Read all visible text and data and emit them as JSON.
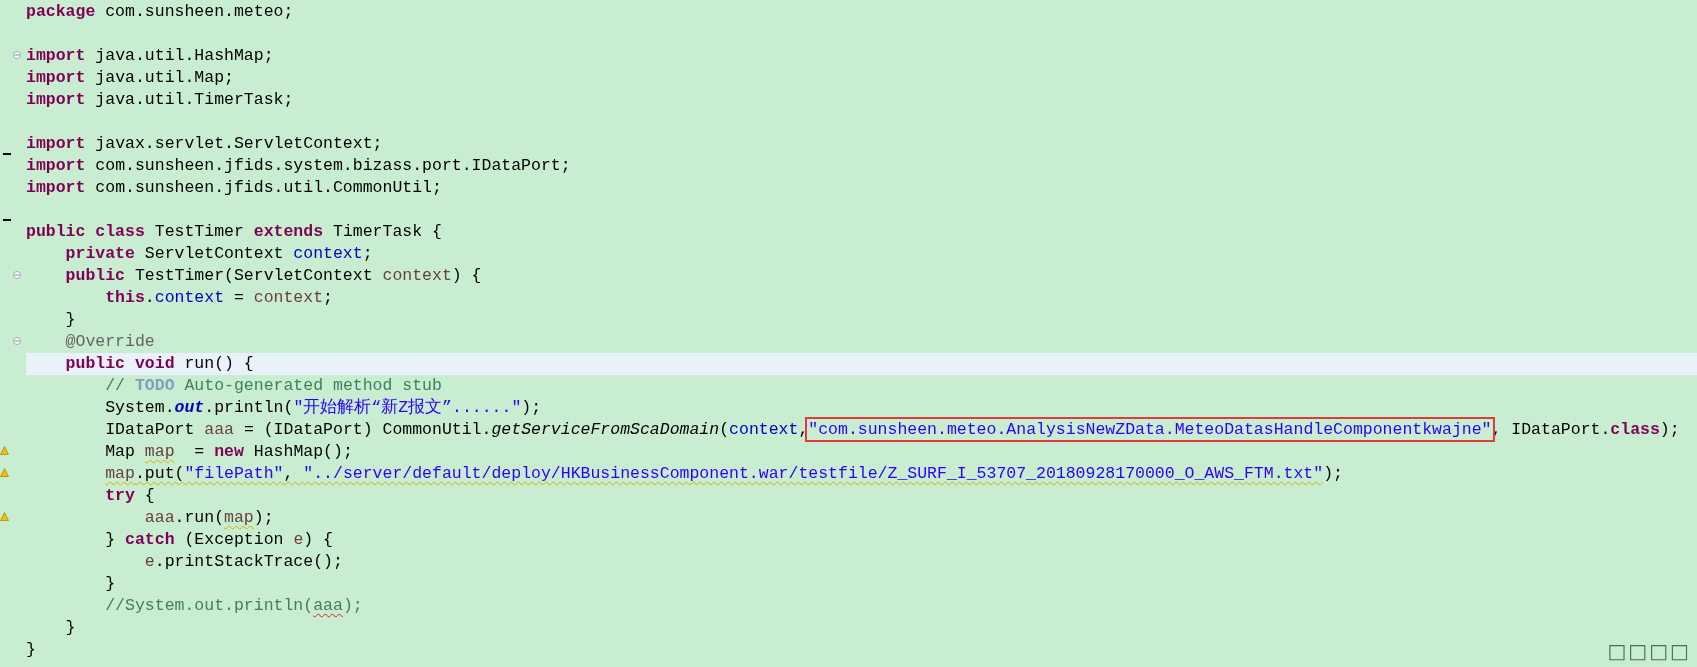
{
  "editor": {
    "lines": [
      {
        "current": false,
        "tokens": [
          {
            "kind": "keyword",
            "text": "package"
          },
          {
            "kind": "plain",
            "text": " com.sunsheen.meteo;"
          }
        ]
      },
      {
        "current": false
      },
      {
        "current": false,
        "expanded": true,
        "tokens": [
          {
            "kind": "keyword",
            "text": "import"
          },
          {
            "kind": "plain",
            "text": " java.util.HashMap;"
          }
        ]
      },
      {
        "current": false,
        "tokens": [
          {
            "kind": "keyword",
            "text": "import"
          },
          {
            "kind": "plain",
            "text": " java.util.Map;"
          }
        ]
      },
      {
        "current": false,
        "tokens": [
          {
            "kind": "keyword",
            "text": "import"
          },
          {
            "kind": "plain",
            "text": " java.util.TimerTask;"
          }
        ]
      },
      {
        "current": false
      },
      {
        "current": false,
        "tokens": [
          {
            "kind": "keyword",
            "text": "import"
          },
          {
            "kind": "plain",
            "text": " javax.servlet.ServletContext;"
          }
        ]
      },
      {
        "current": false,
        "changed": true,
        "tokens": [
          {
            "kind": "keyword",
            "text": "import"
          },
          {
            "kind": "plain",
            "text": " com.sunsheen.jfids.system.bizass.port.IDataPort;"
          }
        ]
      },
      {
        "current": false,
        "tokens": [
          {
            "kind": "keyword",
            "text": "import"
          },
          {
            "kind": "plain",
            "text": " com.sunsheen.jfids.util.CommonUtil;"
          }
        ]
      },
      {
        "current": false
      },
      {
        "current": false,
        "changed": true,
        "tokens": [
          {
            "kind": "keyword",
            "text": "public class"
          },
          {
            "kind": "plain",
            "text": " TestTimer "
          },
          {
            "kind": "keyword",
            "text": "extends"
          },
          {
            "kind": "plain",
            "text": " TimerTask {"
          }
        ]
      },
      {
        "current": false,
        "tokens": [
          {
            "kind": "keyword",
            "text": "    private"
          },
          {
            "kind": "plain",
            "text": " ServletContext "
          },
          {
            "kind": "field",
            "text": "context"
          },
          {
            "kind": "plain",
            "text": ";"
          }
        ]
      },
      {
        "current": false,
        "expanded": true,
        "tokens": [
          {
            "kind": "keyword",
            "text": "    public"
          },
          {
            "kind": "plain",
            "text": " TestTimer(ServletContext "
          },
          {
            "kind": "param",
            "text": "context"
          },
          {
            "kind": "plain",
            "text": ") {"
          }
        ]
      },
      {
        "current": false,
        "tokens": [
          {
            "kind": "keyword",
            "text": "        this"
          },
          {
            "kind": "plain",
            "text": "."
          },
          {
            "kind": "field",
            "text": "context"
          },
          {
            "kind": "plain",
            "text": " = "
          },
          {
            "kind": "param",
            "text": "context"
          },
          {
            "kind": "plain",
            "text": ";"
          }
        ]
      },
      {
        "current": false,
        "tokens": [
          {
            "kind": "plain",
            "text": "    }"
          }
        ]
      },
      {
        "current": false,
        "expanded": true,
        "tokens": [
          {
            "kind": "annotation",
            "text": "    @Override"
          }
        ]
      },
      {
        "current": true,
        "tokens": [
          {
            "kind": "keyword",
            "text": "    public void"
          },
          {
            "kind": "plain",
            "text": " run() {"
          }
        ]
      },
      {
        "current": false,
        "tokens": [
          {
            "kind": "comment",
            "text": "        // "
          },
          {
            "kind": "todo",
            "text": "TODO"
          },
          {
            "kind": "comment",
            "text": " Auto-generated method stub"
          }
        ]
      },
      {
        "current": false,
        "tokens": [
          {
            "kind": "plain",
            "text": "        System."
          },
          {
            "kind": "static",
            "text": "out"
          },
          {
            "kind": "plain",
            "text": ".println("
          },
          {
            "kind": "string",
            "text": "\"开始解析“新Z报文”......\""
          },
          {
            "kind": "plain",
            "text": ");"
          }
        ]
      },
      {
        "current": false,
        "tokens": [
          {
            "kind": "plain",
            "text": "        IDataPort "
          },
          {
            "kind": "param",
            "text": "aaa"
          },
          {
            "kind": "plain",
            "text": " = (IDataPort) CommonUtil."
          },
          {
            "kind": "method",
            "text": "getServiceFromScaDomain"
          },
          {
            "kind": "plain",
            "text": "("
          },
          {
            "kind": "field",
            "text": "context"
          },
          {
            "kind": "plain",
            "text": ","
          },
          {
            "kind": "string",
            "text": "\"com.sunsheen.meteo.AnalysisNewZData.MeteoDatasHandleComponentkwajne\"",
            "boxed": true
          },
          {
            "kind": "plain",
            "text": ", IDataPort."
          },
          {
            "kind": "keyword",
            "text": "class"
          },
          {
            "kind": "plain",
            "text": ");"
          }
        ]
      },
      {
        "current": false,
        "warning": true,
        "tokens": [
          {
            "kind": "plain",
            "text": "        Map "
          },
          {
            "kind": "param",
            "text": "map",
            "warning_underline": true
          },
          {
            "kind": "plain",
            "text": "  = "
          },
          {
            "kind": "keyword",
            "text": "new"
          },
          {
            "kind": "plain",
            "text": " HashMap();"
          }
        ]
      },
      {
        "current": false,
        "warning": true,
        "tokens": [
          {
            "kind": "param",
            "text": "        map",
            "warning_underline": true
          },
          {
            "kind": "plain",
            "text": ".put(",
            "warning_underline": true
          },
          {
            "kind": "string",
            "text": "\"filePath\"",
            "warning_underline": true
          },
          {
            "kind": "plain",
            "text": ", ",
            "warning_underline": true
          },
          {
            "kind": "string",
            "text": "\"../server/default/deploy/HKBusinessComponent.war/testfile/Z_SURF_I_53707_20180928170000_O_AWS_FTM.txt\"",
            "warning_underline": true
          },
          {
            "kind": "plain",
            "text": ");"
          }
        ]
      },
      {
        "current": false,
        "tokens": [
          {
            "kind": "keyword",
            "text": "        try"
          },
          {
            "kind": "plain",
            "text": " {"
          }
        ]
      },
      {
        "current": false,
        "warning": true,
        "tokens": [
          {
            "kind": "param",
            "text": "            aaa"
          },
          {
            "kind": "plain",
            "text": ".run("
          },
          {
            "kind": "param",
            "text": "map",
            "warning_underline": true
          },
          {
            "kind": "plain",
            "text": ");"
          }
        ]
      },
      {
        "current": false,
        "tokens": [
          {
            "kind": "plain",
            "text": "        } "
          },
          {
            "kind": "keyword",
            "text": "catch"
          },
          {
            "kind": "plain",
            "text": " (Exception "
          },
          {
            "kind": "param",
            "text": "e"
          },
          {
            "kind": "plain",
            "text": ") {"
          }
        ]
      },
      {
        "current": false,
        "tokens": [
          {
            "kind": "param",
            "text": "            e"
          },
          {
            "kind": "plain",
            "text": ".printStackTrace();"
          }
        ]
      },
      {
        "current": false,
        "tokens": [
          {
            "kind": "plain",
            "text": "        }"
          }
        ]
      },
      {
        "current": false,
        "tokens": [
          {
            "kind": "comment",
            "text": "        //System.out.println("
          },
          {
            "kind": "comment",
            "text": "aaa",
            "spelling_error": true
          },
          {
            "kind": "comment",
            "text": ");"
          }
        ]
      },
      {
        "current": false,
        "tokens": [
          {
            "kind": "plain",
            "text": "    }"
          }
        ]
      },
      {
        "current": false,
        "tokens": [
          {
            "kind": "plain",
            "text": "}"
          }
        ]
      }
    ]
  },
  "status_glyphs": "□□□□"
}
